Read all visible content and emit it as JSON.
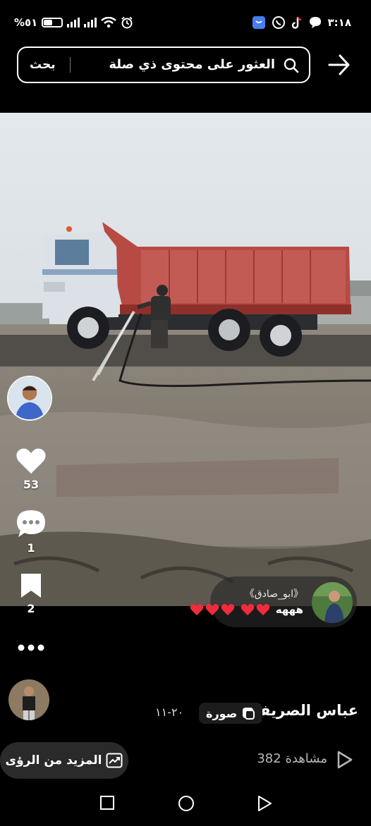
{
  "status_bar": {
    "battery": "%٥١",
    "time": "٣:١٨",
    "battery_level": 0.51
  },
  "search": {
    "placeholder": "العثور على محتوى ذي صلة",
    "button_label": "بحث"
  },
  "icons": {
    "back": "arrow-right-icon",
    "search": "search-icon",
    "like": "heart-icon",
    "comment": "comment-bubble-icon",
    "save": "bookmark-icon",
    "more": "more-dots-icon",
    "insights": "trending-chart-icon",
    "play": "play-icon"
  },
  "actions": {
    "likes": "53",
    "comments": "1",
    "saves": "2"
  },
  "comment": {
    "author": "《ابو_صادق》",
    "text": "هههه"
  },
  "post": {
    "author": "عباس الصريفي",
    "type_label": "صورة",
    "date": "٢٠-١١"
  },
  "insights": {
    "label": "المزيد من الرؤى"
  },
  "views": {
    "text": "382 مشاهدة"
  },
  "colors": {
    "background": "#000000",
    "heart": "#f02b3b",
    "truck_body": "#b84a44"
  }
}
